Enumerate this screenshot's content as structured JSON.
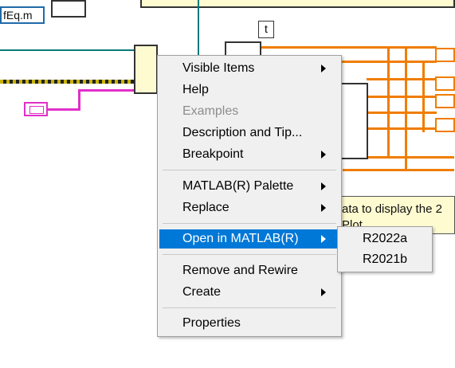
{
  "diagram": {
    "filename_fragment": "fEq.m",
    "terminal_label": "t",
    "comment_fragment": "ata to display the 2",
    "comment_fragment_2": "Plot",
    "colors": {
      "wire_orange": "#f07d00",
      "wire_teal": "#0a7a7a",
      "wire_pink": "#e030c8",
      "comment_bg": "#fffbd0"
    }
  },
  "context_menu": {
    "items": [
      {
        "label": "Visible Items",
        "submenu": true
      },
      {
        "label": "Help"
      },
      {
        "label": "Examples",
        "disabled": true
      },
      {
        "label": "Description and Tip..."
      },
      {
        "label": "Breakpoint",
        "submenu": true
      },
      {
        "label": "MATLAB(R) Palette",
        "submenu": true
      },
      {
        "label": "Replace",
        "submenu": true
      },
      {
        "label": "Open in MATLAB(R)",
        "submenu": true,
        "highlighted": true
      },
      {
        "label": "Remove and Rewire"
      },
      {
        "label": "Create",
        "submenu": true
      },
      {
        "label": "Properties"
      }
    ],
    "highlight_color": "#0078d7"
  },
  "submenu": {
    "items": [
      {
        "label": "R2022a"
      },
      {
        "label": "R2021b"
      }
    ]
  }
}
